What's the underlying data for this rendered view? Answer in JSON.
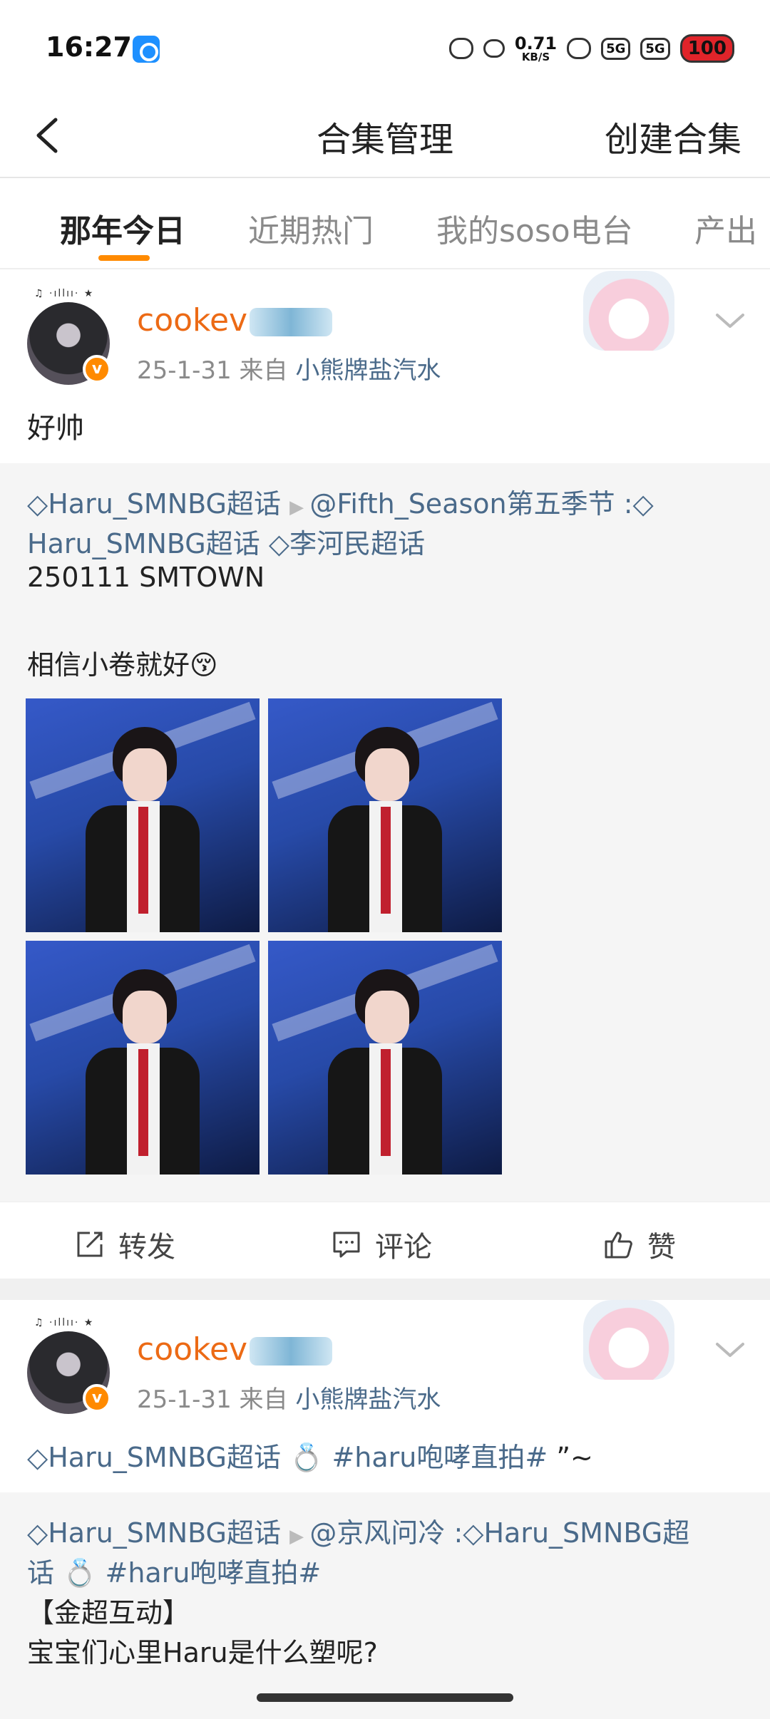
{
  "status_bar": {
    "time": "16:27",
    "net_speed": "0.71",
    "net_unit": "KB/S",
    "signal_1": "5G",
    "signal_2": "5G",
    "battery": "100",
    "icons": [
      "app-icon",
      "notification-icon",
      "bow-icon",
      "wifi-icon",
      "signal-icon",
      "signal-icon",
      "battery-icon"
    ]
  },
  "header": {
    "title": "合集管理",
    "action": "创建合集"
  },
  "tabs": [
    {
      "label": "那年今日",
      "active": true
    },
    {
      "label": "近期热门"
    },
    {
      "label": "我的soso电台"
    },
    {
      "label": "产出"
    }
  ],
  "posts": [
    {
      "user": "cookev",
      "date": "25-1-31",
      "from_prefix": "来自",
      "source": "小熊牌盐汽水",
      "text": "好帅",
      "repost": {
        "line1_a": "Haru_SMNBG超话",
        "line1_b": "@Fifth_Season第五季节",
        "line1_c": " :",
        "line2_a": "Haru_SMNBG超话",
        "line2_b": "李河民超话",
        "line3": "250111 SMTOWN",
        "line4": "相信小卷就好😚"
      }
    },
    {
      "user": "cookev",
      "date": "25-1-31",
      "from_prefix": "来自",
      "source": "小熊牌盐汽水",
      "text_a": "Haru_SMNBG超话",
      "text_b": " 💍 ",
      "text_c": "#haru咆哮直拍#",
      "text_d": " ”~",
      "repost": {
        "line1_a": "Haru_SMNBG超话",
        "line1_b": "@京风问冷",
        "line1_c": " :",
        "line1_d": "Haru_SMNBG超",
        "line2_a": "话",
        "line2_b": " 💍 ",
        "line2_c": "#haru咆哮直拍#",
        "line3": "【金超互动】",
        "line4": "宝宝们心里Haru是什么塑呢?"
      }
    }
  ],
  "actions": {
    "repost": "转发",
    "comment": "评论",
    "like": "赞"
  },
  "colors": {
    "username": "#ec6a15",
    "link": "#4a6a8a",
    "tab_indicator": "#ff8a00",
    "repost_bg": "#f5f5f5"
  }
}
